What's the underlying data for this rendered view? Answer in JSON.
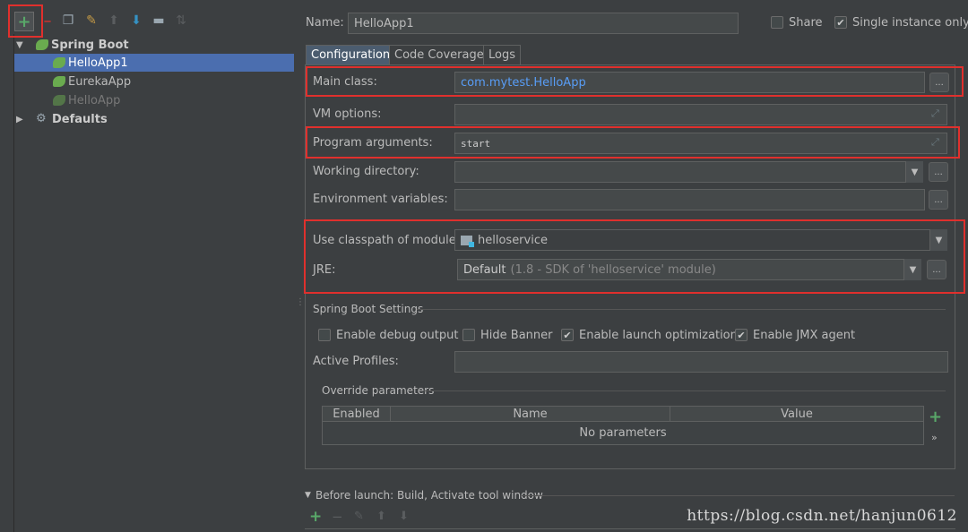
{
  "toolbar": {
    "icons": [
      "add-icon",
      "minus-icon",
      "copy-icon",
      "wrench-icon",
      "arrow-up-icon",
      "arrow-down-icon",
      "folder-icon",
      "sort-icon"
    ]
  },
  "tree": {
    "spring_boot": "Spring Boot",
    "items": [
      "HelloApp1",
      "EurekaApp",
      "HelloApp"
    ],
    "defaults": "Defaults"
  },
  "header": {
    "name_label": "Name:",
    "name_value": "HelloApp1",
    "share_label": "Share",
    "single_instance_label": "Single instance only"
  },
  "tabs": [
    "Configuration",
    "Code Coverage",
    "Logs"
  ],
  "config": {
    "main_class_label": "Main class:",
    "main_class_value": "com.mytest.HelloApp",
    "vm_options_label": "VM options:",
    "program_args_label": "Program arguments:",
    "program_args_value": "start",
    "working_dir_label": "Working directory:",
    "env_vars_label": "Environment variables:",
    "classpath_label": "Use classpath of module:",
    "classpath_value": "helloservice",
    "jre_label": "JRE:",
    "jre_value": "Default",
    "jre_detail": "(1.8 - SDK of 'helloservice' module)",
    "more_button": "..."
  },
  "spring_boot_settings": {
    "title": "Spring Boot Settings",
    "debug_output": "Enable debug output",
    "hide_banner": "Hide Banner",
    "launch_optimization": "Enable launch optimization",
    "jmx_agent": "Enable JMX agent",
    "active_profiles_label": "Active Profiles:",
    "override_title": "Override parameters",
    "columns": [
      "Enabled",
      "Name",
      "Value"
    ],
    "empty_text": "No parameters"
  },
  "before_launch": {
    "label": "Before launch: Build, Activate tool window"
  },
  "watermark": "https://blog.csdn.net/hanjun0612",
  "colors": {
    "highlight": "#e0302d",
    "selection": "#4b6eaf",
    "link": "#589df6",
    "add_green": "#59a869"
  }
}
